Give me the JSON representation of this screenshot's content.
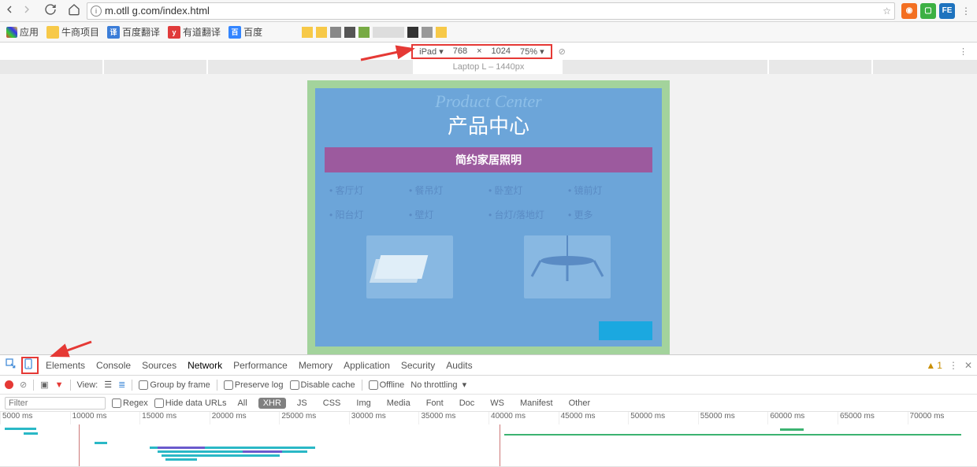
{
  "browser": {
    "url": "m.otll        g.com/index.html"
  },
  "bookmarks": {
    "apps": "应用",
    "items": [
      "牛商项目",
      "百度翻译",
      "有道翻译",
      "百度"
    ]
  },
  "device_toolbar": {
    "device": "iPad",
    "width": "768",
    "sep": "×",
    "height": "1024",
    "zoom": "75%",
    "ruler_label": "Laptop L – 1440px"
  },
  "page": {
    "title_en": "Product Center",
    "title_cn": "产品中心",
    "banner": "简约家居照明",
    "links": [
      "客厅灯",
      "餐吊灯",
      "卧室灯",
      "镜前灯",
      "阳台灯",
      "壁灯",
      "台灯/落地灯",
      "更多"
    ]
  },
  "devtools": {
    "tabs": [
      "Elements",
      "Console",
      "Sources",
      "Network",
      "Performance",
      "Memory",
      "Application",
      "Security",
      "Audits"
    ],
    "warn_count": "1",
    "netbar": {
      "view": "View:",
      "group": "Group by frame",
      "preserve": "Preserve log",
      "disable_cache": "Disable cache",
      "offline": "Offline",
      "throttling": "No throttling"
    },
    "filter": {
      "placeholder": "Filter",
      "regex": "Regex",
      "hide": "Hide data URLs",
      "types": [
        "All",
        "XHR",
        "JS",
        "CSS",
        "Img",
        "Media",
        "Font",
        "Doc",
        "WS",
        "Manifest",
        "Other"
      ]
    },
    "time_ticks": [
      "5000 ms",
      "10000 ms",
      "15000 ms",
      "20000 ms",
      "25000 ms",
      "30000 ms",
      "35000 ms",
      "40000 ms",
      "45000 ms",
      "50000 ms",
      "55000 ms",
      "60000 ms",
      "65000 ms",
      "70000 ms"
    ]
  }
}
